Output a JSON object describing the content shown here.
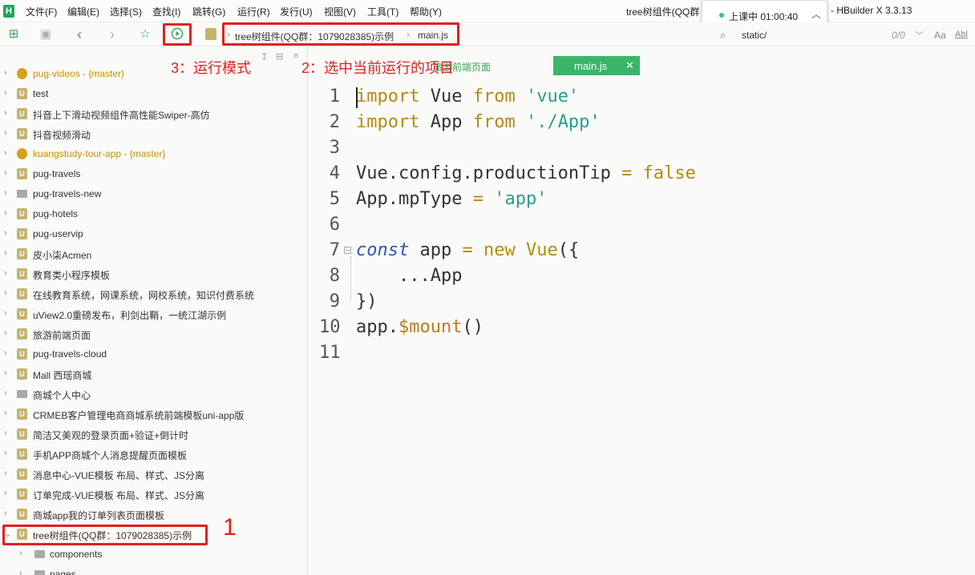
{
  "app": {
    "logo": "H",
    "title_left": "tree树组件(QQ群",
    "title_right": "- HBuilder X 3.3.13"
  },
  "menu": [
    "文件(F)",
    "编辑(E)",
    "选择(S)",
    "查找(I)",
    "跳转(G)",
    "运行(R)",
    "发行(U)",
    "视图(V)",
    "工具(T)",
    "帮助(Y)"
  ],
  "popup": {
    "text": "上课中 01:00:40",
    "status_color": "#2ecc71"
  },
  "breadcrumb": {
    "project": "tree树组件(QQ群：1079028385)示例",
    "file": "main.js"
  },
  "search": {
    "text": "static/",
    "count": "0/0",
    "case": "Aa",
    "word": "Abl"
  },
  "annotations": {
    "a1": "1",
    "a2": "2：选中当前运行的项目",
    "a3": "3：运行模式"
  },
  "tabs": {
    "inactive": "旅游前端页面",
    "active": "main.js",
    "close": "✕"
  },
  "explorer": [
    {
      "label": "pug-videos",
      "branch": " - {master}",
      "type": "git"
    },
    {
      "label": "test",
      "type": "uni"
    },
    {
      "label": "抖音上下滑动视频组件高性能Swiper-高仿",
      "type": "uni"
    },
    {
      "label": "抖音视频滑动",
      "type": "uni"
    },
    {
      "label": "kuangstudy-tour-app",
      "branch": " - {master}",
      "type": "git"
    },
    {
      "label": "pug-travels",
      "type": "uni"
    },
    {
      "label": "pug-travels-new",
      "type": "folder"
    },
    {
      "label": "pug-hotels",
      "type": "uni"
    },
    {
      "label": "pug-uservip",
      "type": "uni"
    },
    {
      "label": "皮小柒Acmen",
      "type": "uni"
    },
    {
      "label": "教育类小程序模板",
      "type": "uni"
    },
    {
      "label": "在线教育系统，网课系统，网校系统，知识付费系统",
      "type": "uni"
    },
    {
      "label": "uView2.0重磅发布，利剑出鞘，一统江湖示例",
      "type": "uni"
    },
    {
      "label": "旅游前端页面",
      "type": "uni"
    },
    {
      "label": "pug-travels-cloud",
      "type": "uni"
    },
    {
      "label": "Mall 西瑶商城",
      "type": "uni"
    },
    {
      "label": "商城个人中心",
      "type": "folder"
    },
    {
      "label": "CRMEB客户管理电商商城系统前端模板uni-app版",
      "type": "uni"
    },
    {
      "label": "简洁又美观的登录页面+验证+倒计时",
      "type": "uni"
    },
    {
      "label": "手机APP商城个人消息提醒页面模板",
      "type": "uni"
    },
    {
      "label": "消息中心-VUE模板 布局、样式、JS分离",
      "type": "uni"
    },
    {
      "label": "订单完成-VUE模板 布局、样式、JS分离",
      "type": "uni"
    },
    {
      "label": "商城app我的订单列表页面模板",
      "type": "uni"
    },
    {
      "label": "tree树组件(QQ群：1079028385)示例",
      "type": "uni",
      "expanded": true
    },
    {
      "label": "components",
      "type": "folder",
      "sub": true
    },
    {
      "label": "pages",
      "type": "folder",
      "sub": true
    }
  ],
  "code": [
    {
      "n": "1",
      "tokens": [
        [
          "import",
          "kw"
        ],
        [
          " Vue ",
          ""
        ],
        [
          "from",
          "kw"
        ],
        [
          " ",
          ""
        ],
        [
          "'vue'",
          "str"
        ]
      ]
    },
    {
      "n": "2",
      "tokens": [
        [
          "import",
          "kw"
        ],
        [
          " App ",
          ""
        ],
        [
          "from",
          "kw"
        ],
        [
          " ",
          ""
        ],
        [
          "'./App'",
          "str"
        ]
      ]
    },
    {
      "n": "3",
      "tokens": []
    },
    {
      "n": "4",
      "tokens": [
        [
          "Vue.config.productionTip ",
          ""
        ],
        [
          "=",
          "op"
        ],
        [
          " ",
          ""
        ],
        [
          "false",
          "kw"
        ]
      ]
    },
    {
      "n": "5",
      "tokens": [
        [
          "App.mpType ",
          ""
        ],
        [
          "=",
          "op"
        ],
        [
          " ",
          ""
        ],
        [
          "'app'",
          "str"
        ]
      ]
    },
    {
      "n": "6",
      "tokens": []
    },
    {
      "n": "7",
      "tokens": [
        [
          "const",
          "kw-blue"
        ],
        [
          " app ",
          ""
        ],
        [
          "=",
          "op"
        ],
        [
          " ",
          ""
        ],
        [
          "new",
          "kw"
        ],
        [
          " ",
          ""
        ],
        [
          "Vue",
          "kw"
        ],
        [
          "({",
          ""
        ]
      ],
      "fold": "⊟"
    },
    {
      "n": "8",
      "tokens": [
        [
          "    ...App",
          ""
        ]
      ]
    },
    {
      "n": "9",
      "tokens": [
        [
          "})",
          ""
        ]
      ]
    },
    {
      "n": "10",
      "tokens": [
        [
          "app.",
          ""
        ],
        [
          "$mount",
          "fn"
        ],
        [
          "()",
          ""
        ]
      ]
    },
    {
      "n": "11",
      "tokens": []
    }
  ]
}
